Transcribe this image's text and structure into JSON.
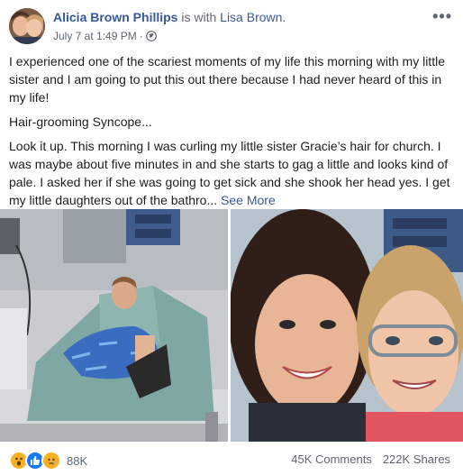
{
  "post": {
    "author": "Alicia Brown Phillips",
    "with_text": "is with",
    "tagged": "Lisa Brown.",
    "timestamp": "July 7 at 1:49 PM",
    "separator": "·",
    "more_label": "•••",
    "paragraphs": [
      "I experienced one of the scariest moments of my life this morning with my little sister and I am going to put this out there because I had never heard of this in my life!",
      "Hair-grooming Syncope...",
      "Look it up. This morning I was curling my little sister Gracie’s hair for church. I was maybe about five minutes in and she starts to gag a little and looks kind of pale. I asked her if she was going to get sick and she shook her head yes. I get my little daughters out of the bathro..."
    ],
    "see_more": "See More"
  },
  "icons": {
    "avatar": "profile-photo",
    "privacy": "globe-icon",
    "more": "more-options-icon",
    "reactions": [
      "wow-reaction-icon",
      "like-reaction-icon",
      "sad-reaction-icon"
    ]
  },
  "colors": {
    "link": "#385898",
    "meta": "#606770",
    "text": "#1c1e21",
    "like": "#1877f2",
    "wow": "#f7b125"
  },
  "footer": {
    "reaction_count": "88K",
    "comments": "45K Comments",
    "shares": "222K Shares"
  }
}
